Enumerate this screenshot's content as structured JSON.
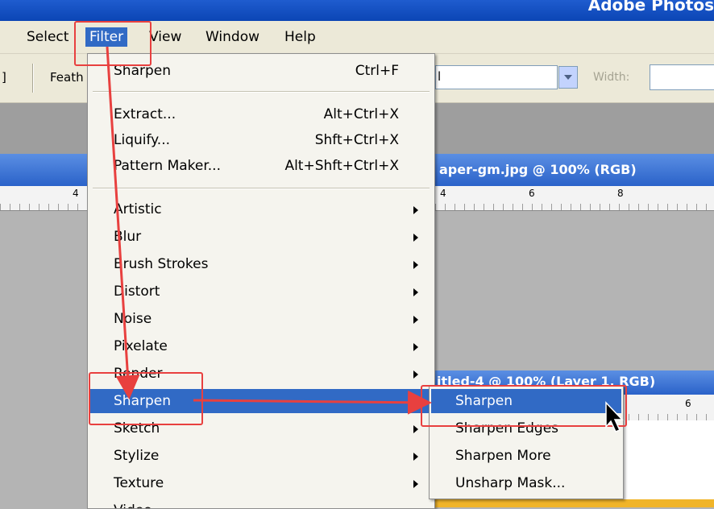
{
  "app": {
    "title": "Adobe Photos"
  },
  "menubar": {
    "items": [
      "Select",
      "Filter",
      "View",
      "Window",
      "Help"
    ],
    "active": "Filter"
  },
  "options": {
    "prefix": "]",
    "feather_label": "Feath",
    "mode_value": "l",
    "width_label": "Width:"
  },
  "doc1": {
    "title": "aper-gm.jpg @ 100% (RGB)",
    "ruler_left": "4",
    "ruler": [
      "4",
      "6",
      "8"
    ]
  },
  "doc2": {
    "title": "itled-4 @ 100% (Layer 1, RGB)",
    "ruler": [
      "6"
    ]
  },
  "filter_menu": {
    "last_filter": {
      "label": "Sharpen",
      "shortcut": "Ctrl+F"
    },
    "group2": [
      {
        "label": "Extract...",
        "shortcut": "Alt+Ctrl+X"
      },
      {
        "label": "Liquify...",
        "shortcut": "Shft+Ctrl+X"
      },
      {
        "label": "Pattern Maker...",
        "shortcut": "Alt+Shft+Ctrl+X"
      }
    ],
    "submenus": [
      "Artistic",
      "Blur",
      "Brush Strokes",
      "Distort",
      "Noise",
      "Pixelate",
      "Render",
      "Sharpen",
      "Sketch",
      "Stylize",
      "Texture",
      "Video"
    ],
    "highlighted": "Sharpen"
  },
  "sharpen_submenu": {
    "items": [
      "Sharpen",
      "Sharpen Edges",
      "Sharpen More",
      "Unsharp Mask..."
    ],
    "highlighted": "Sharpen"
  },
  "colors": {
    "highlight": "#316ac5",
    "annotation": "#e8403f",
    "titlebar": "#0b45b5"
  }
}
